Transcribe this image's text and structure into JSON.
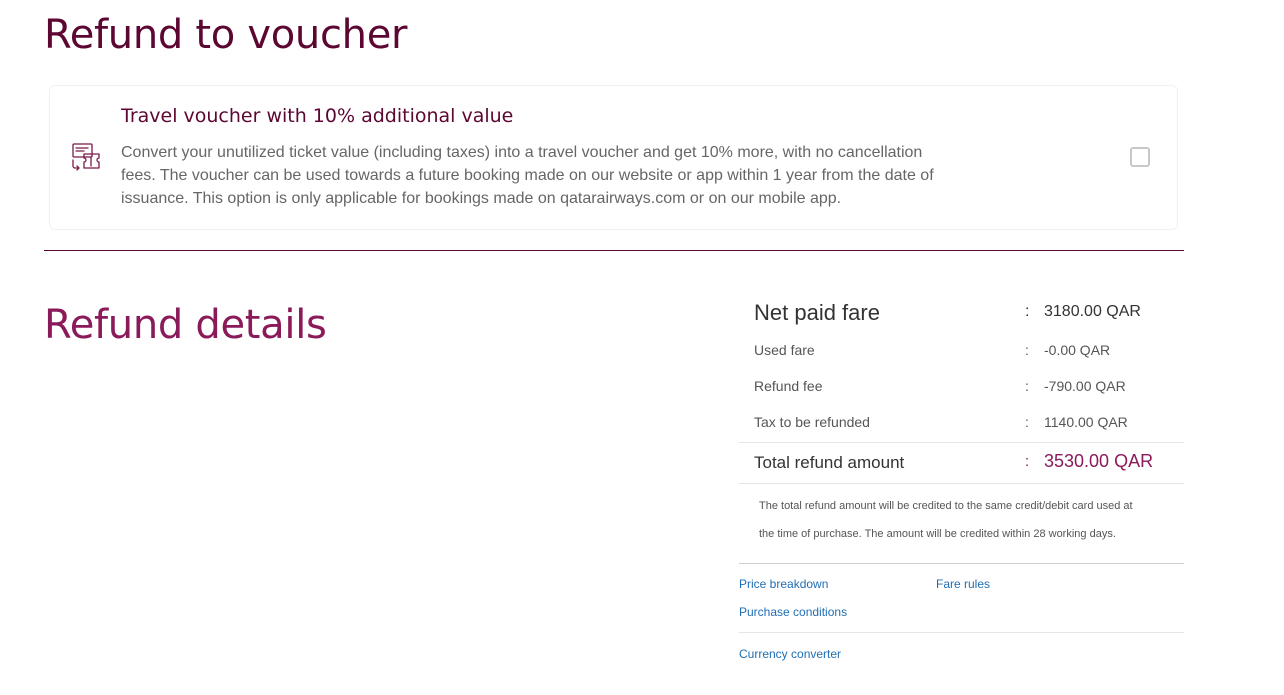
{
  "voucher_section": {
    "heading": "Refund to voucher",
    "card": {
      "icon": "voucher-ticket-icon",
      "title": "Travel voucher with 10% additional value",
      "description": "Convert your unutilized ticket value (including taxes) into a travel voucher and get 10% more, with no cancellation fees. The voucher can be used towards a future booking made on our website or app within 1 year from the date of issuance. This option is only applicable for bookings made on qatarairways.com or on our mobile app.",
      "checked": false
    }
  },
  "details_section": {
    "heading": "Refund details"
  },
  "summary": {
    "separator": ":",
    "net_paid": {
      "label": "Net paid fare",
      "value": "3180.00 QAR"
    },
    "used_fare": {
      "label": "Used fare",
      "value": "-0.00 QAR"
    },
    "refund_fee": {
      "label": "Refund fee",
      "value": "-790.00 QAR"
    },
    "tax_refunded": {
      "label": "Tax to be refunded",
      "value": "1140.00 QAR"
    },
    "total": {
      "label": "Total refund amount",
      "value": "3530.00 QAR"
    },
    "note_line1": "The total refund amount will be credited to the same credit/debit card used at",
    "note_line2": "the time of purchase. The amount will be credited within 28 working days."
  },
  "links": {
    "price_breakdown": "Price breakdown",
    "fare_rules": "Fare rules",
    "purchase_conditions": "Purchase conditions",
    "currency_converter": "Currency converter"
  },
  "colors": {
    "brand_maroon": "#5c0632",
    "accent_purple": "#8a1a5a",
    "link_blue": "#1f6eb5"
  }
}
